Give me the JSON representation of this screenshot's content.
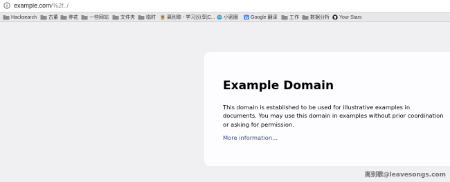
{
  "address_bar": {
    "url_host": "example.com",
    "url_path": "/%2f../"
  },
  "bookmarks": [
    {
      "label": "Hacksearch",
      "icon": "folder-icon"
    },
    {
      "label": "古董",
      "icon": "folder-icon"
    },
    {
      "label": "养花",
      "icon": "folder-icon"
    },
    {
      "label": "一些网站",
      "icon": "folder-icon"
    },
    {
      "label": "文件夹",
      "icon": "folder-icon"
    },
    {
      "label": "临时",
      "icon": "folder-icon"
    },
    {
      "label": "离别歌 - 学习|分享|C...",
      "icon": "bookmark-page-icon"
    },
    {
      "label": "小密圈",
      "icon": "globe-icon"
    },
    {
      "label": "Google 翻译",
      "icon": "google-translate-icon"
    },
    {
      "label": "工作",
      "icon": "folder-icon"
    },
    {
      "label": "数据分析",
      "icon": "folder-icon"
    },
    {
      "label": "Your Stars",
      "icon": "github-icon"
    }
  ],
  "content": {
    "title": "Example Domain",
    "paragraph": "This domain is established to be used for illustrative examples in documents. You may use this domain in examples without prior coordination or asking for permission.",
    "link_text": "More information..."
  },
  "watermark": "离别歌@leavesongs.com",
  "colors": {
    "page_background": "#f0f0f2",
    "card_background": "#fdfdff",
    "link": "#38488f"
  }
}
